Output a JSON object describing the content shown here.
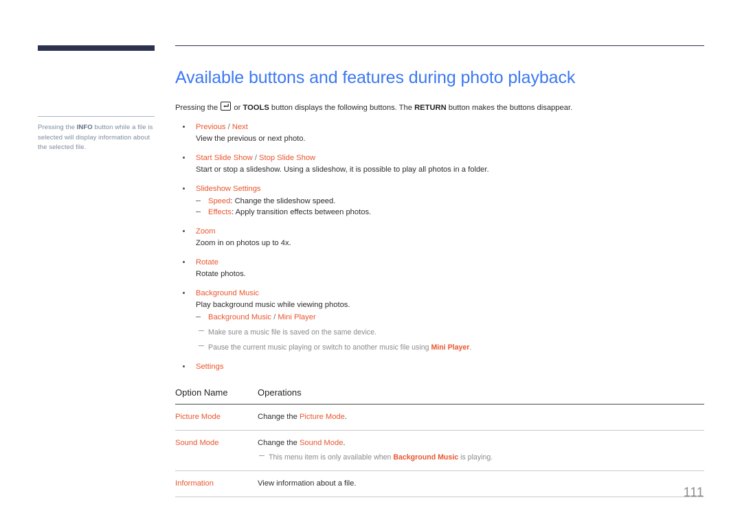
{
  "sidebar": {
    "note_prefix": "Pressing the ",
    "note_keyword": "INFO",
    "note_suffix": " button while a file is selected will display information about the selected file."
  },
  "header": {
    "title": "Available buttons and features during photo playback"
  },
  "intro": {
    "part1": "Pressing the ",
    "icon": "enter-key-icon",
    "part2": " or ",
    "tools": "TOOLS",
    "part3": " button displays the following buttons. The ",
    "return": "RETURN",
    "part4": " button makes the buttons disappear."
  },
  "features": [
    {
      "title": "Previous / Next",
      "title_a": "Previous",
      "separator": " / ",
      "title_b": "Next",
      "description": "View the previous or next photo."
    },
    {
      "title": "Start Slide Show / Stop Slide Show",
      "title_a": "Start Slide Show",
      "separator": " / ",
      "title_b": "Stop Slide Show",
      "description": "Start or stop a slideshow. Using a slideshow, it is possible to play all photos in a folder."
    },
    {
      "title": "Slideshow Settings",
      "sub_items": [
        {
          "term": "Speed",
          "text": ": Change the slideshow speed."
        },
        {
          "term": "Effects",
          "text": ": Apply transition effects between photos."
        }
      ]
    },
    {
      "title": "Zoom",
      "description": "Zoom in on photos up to 4x."
    },
    {
      "title": "Rotate",
      "description": "Rotate photos."
    },
    {
      "title": "Background Music",
      "description": "Play background music while viewing photos.",
      "sub_items": [
        {
          "term_a": "Background Music",
          "separator": " / ",
          "term_b": "Mini Player"
        }
      ],
      "notes": [
        {
          "text": "Make sure a music file is saved on the same device."
        },
        {
          "pre": "Pause the current music playing or switch to another music file using ",
          "bold": "Mini Player",
          "post": "."
        }
      ]
    },
    {
      "title": "Settings"
    }
  ],
  "table": {
    "headers": [
      "Option Name",
      "Operations"
    ],
    "rows": [
      {
        "option": "Picture Mode",
        "op_pre": "Change the ",
        "op_term": "Picture Mode",
        "op_post": "."
      },
      {
        "option": "Sound Mode",
        "op_pre": "Change the ",
        "op_term": "Sound Mode",
        "op_post": ".",
        "note_pre": "This menu item is only available when ",
        "note_bold": "Background Music",
        "note_post": " is playing."
      },
      {
        "option": "Information",
        "op_pre": "View information about a file.",
        "op_term": "",
        "op_post": ""
      }
    ]
  },
  "footer": {
    "page_number": "111"
  },
  "colors": {
    "navy": "#2c3150",
    "title_blue": "#3c78f0",
    "accent_orange": "#e8552d",
    "note_gray": "#8a8a8a",
    "page_number_gray": "#8d8d8d"
  }
}
